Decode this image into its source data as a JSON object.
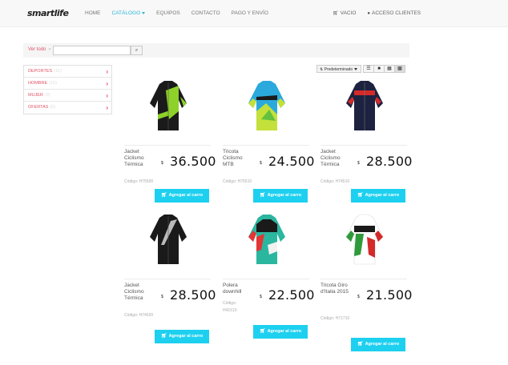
{
  "header": {
    "logo": "smartlife",
    "nav": [
      {
        "label": "HOME",
        "active": false
      },
      {
        "label": "CATÁLOGO",
        "active": true,
        "dropdown": true
      },
      {
        "label": "EQUIPOS",
        "active": false
      },
      {
        "label": "CONTACTO",
        "active": false
      },
      {
        "label": "PAGO Y ENVÍO",
        "active": false
      }
    ],
    "cart_label": "VACIO",
    "account_label": "ACCESO CLIENTES",
    "cart_icon": "cart-icon",
    "user_icon": "user-icon"
  },
  "filters": {
    "breadcrumb": "Ver todo",
    "search_placeholder": "",
    "search_icon": "search-icon"
  },
  "categories": [
    {
      "label": "DEPORTES",
      "count": "(15)"
    },
    {
      "label": "HOMBRE",
      "count": "(15)"
    },
    {
      "label": "MUJER",
      "count": "(0)"
    },
    {
      "label": "OFERTAS",
      "count": "(0)"
    }
  ],
  "sort": {
    "selected": "Predeterminado",
    "view_modes": [
      "list",
      "grid-large",
      "grid-medium",
      "grid-small"
    ],
    "active_view": "grid-small"
  },
  "products": [
    {
      "name": "Jacket Ciclismo Térmica",
      "currency": "$",
      "price": "36.500",
      "code": "Código: H75500",
      "button": "Agregar al carro",
      "colors": {
        "main": "#1a1a1a",
        "accent": "#8dd12a"
      }
    },
    {
      "name": "Tricota Ciclismo MTB",
      "currency": "$",
      "price": "24.500",
      "code": "Código: H75510",
      "button": "Agregar al carro",
      "colors": {
        "main": "#2ba9dc",
        "accent": "#c4e03a"
      }
    },
    {
      "name": "Jacket Ciclismo Térmica",
      "currency": "$",
      "price": "28.500",
      "code": "Código: H74510",
      "button": "Agregar al carro",
      "colors": {
        "main": "#1c2240",
        "accent": "#d42a2a"
      }
    },
    {
      "name": "Jacket Ciclismo Térmica",
      "currency": "$",
      "price": "28.500",
      "code": "Código: H74520",
      "button": "Agregar al carro",
      "colors": {
        "main": "#1a1a1a",
        "accent": "#bbbbbb"
      }
    },
    {
      "name": "Polera downhill",
      "currency": "$",
      "price": "22.500",
      "code": "Código: H41510",
      "button": "Agregar al carro",
      "colors": {
        "main": "#2bb6a0",
        "accent": "#e23535"
      }
    },
    {
      "name": "Tricota Giro d'Italia 2015",
      "currency": "$",
      "price": "21.500",
      "code": "Código: H71710",
      "button": "Agregar al carro",
      "colors": {
        "main": "#ffffff",
        "accent": "#2e9a3a"
      }
    }
  ],
  "theme": {
    "accent": "#1dd0ef",
    "link": "#e05569",
    "nav_active": "#29b6dc"
  }
}
